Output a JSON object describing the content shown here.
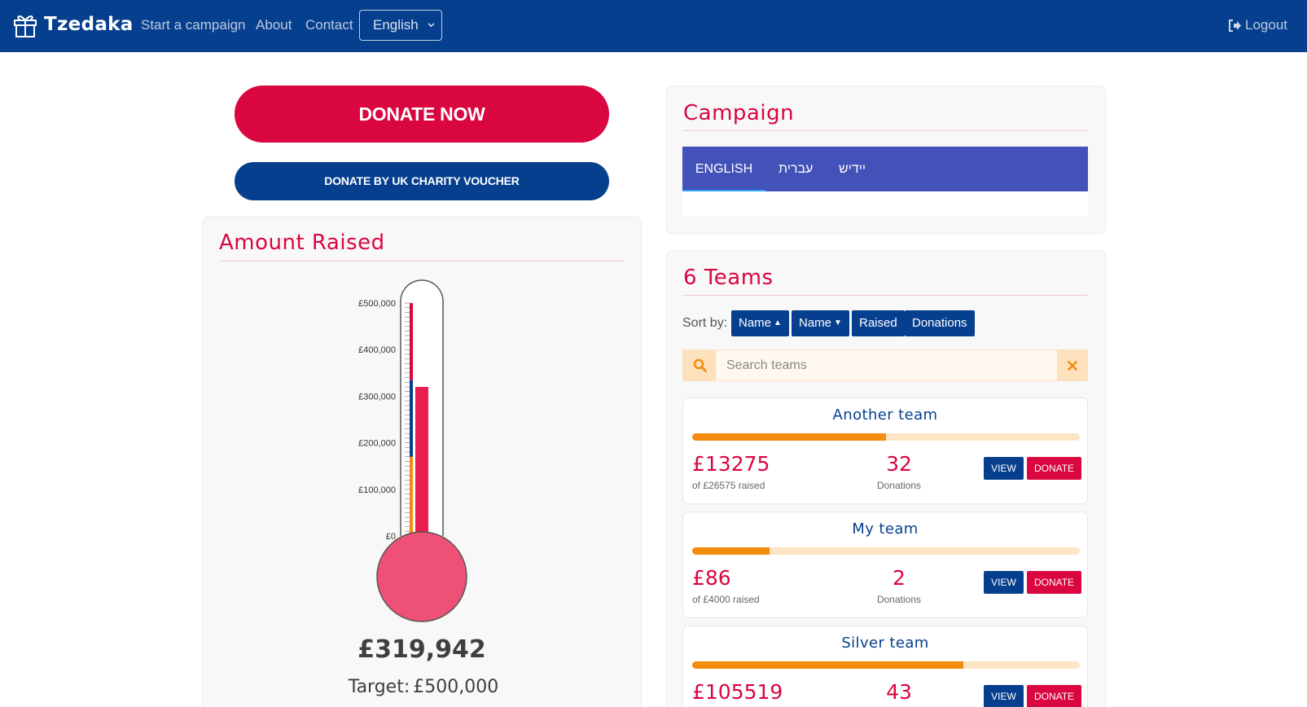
{
  "navbar": {
    "brand": "Tzedaka",
    "links": [
      "Start a campaign",
      "About",
      "Contact"
    ],
    "language_selected": "English",
    "logout_label": "Logout",
    "background": "#073f8f"
  },
  "donate": {
    "now_label": "DONATE NOW",
    "voucher_label": "DONATE BY UK CHARITY VOUCHER"
  },
  "amount_raised": {
    "title": "Amount Raised",
    "total": "£319,942",
    "target_label": "Target:",
    "target_value": "£500,000",
    "thermometer": {
      "max": 500000,
      "raised": 319942,
      "axis_max": 500000,
      "axis_ticks": [
        "£0",
        "£100,000",
        "£200,000",
        "£300,000",
        "£400,000",
        "£500,000"
      ],
      "scale_segments": [
        {
          "from": 0,
          "to": 170000,
          "color": "#f38c0c"
        },
        {
          "from": 170000,
          "to": 335000,
          "color": "#073f8f"
        },
        {
          "from": 335000,
          "to": 500000,
          "color": "#d90640"
        }
      ],
      "mercury_color": "#e81f4f",
      "bulb_color": "#ee5076"
    }
  },
  "campaign": {
    "title": "Campaign",
    "tabs": [
      "ENGLISH",
      "עברית",
      "יידיש"
    ],
    "active_tab": 0
  },
  "teams": {
    "title": "6 Teams",
    "sort_label": "Sort by:",
    "sort_buttons": [
      {
        "label": "Name",
        "icon": "caret-up"
      },
      {
        "label": "Name",
        "icon": "caret-down"
      },
      {
        "label": "Raised"
      },
      {
        "label": "Donations"
      }
    ],
    "search_placeholder": "Search teams",
    "view_label": "VIEW",
    "donate_label": "DONATE",
    "donations_label": "Donations",
    "items": [
      {
        "name": "Another team",
        "raised": "£13275",
        "target_text": "of £26575 raised",
        "donations": "32",
        "progress": 0.5
      },
      {
        "name": "My team",
        "raised": "£86",
        "target_text": "of £4000 raised",
        "donations": "2",
        "progress": 0.2
      },
      {
        "name": "Silver team",
        "raised": "£105519",
        "target_text": "",
        "donations": "43",
        "progress": 0.7
      }
    ]
  }
}
